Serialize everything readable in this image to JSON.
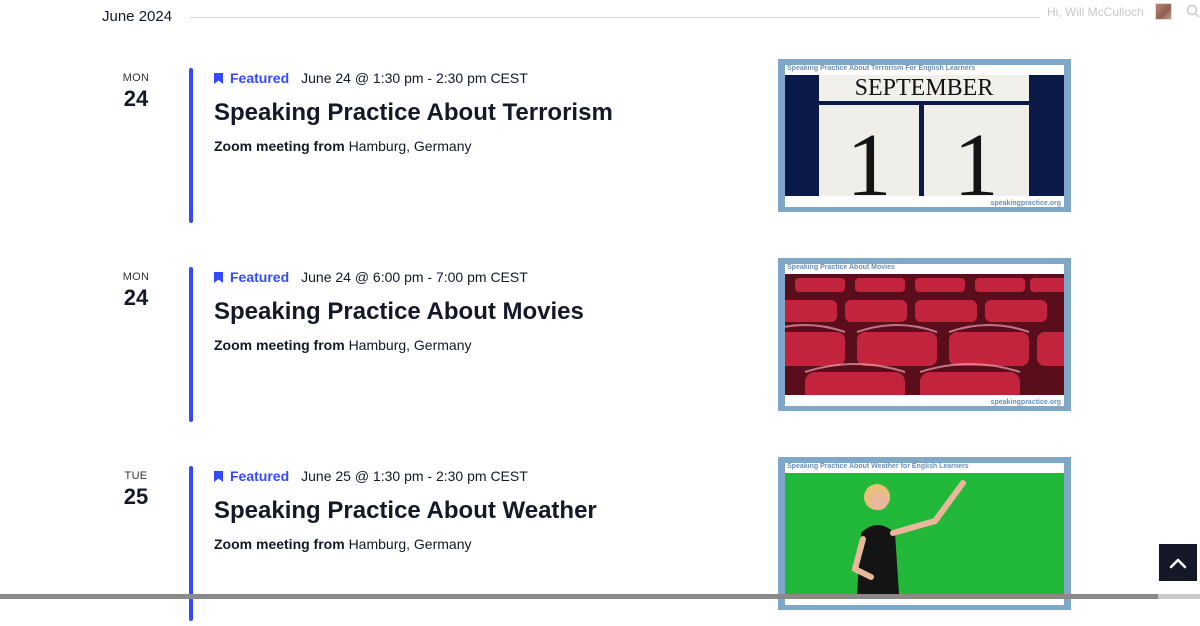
{
  "month": {
    "label": "June 2024"
  },
  "admin": {
    "greeting": "Hi, Will McCulloch"
  },
  "colors": {
    "accent": "#334aff",
    "text": "#141827",
    "thumb_border": "#7fa7c8"
  },
  "events": [
    {
      "weekday": "MON",
      "day": "24",
      "featured_label": "Featured",
      "datetime": "June 24 @ 1:30 pm - 2:30 pm CEST",
      "title": "Speaking Practice About Terrorism",
      "venue_label": "Zoom meeting from",
      "venue_location": "Hamburg, Germany",
      "thumb_caption": "Speaking Practice About Terrorism For English Learners",
      "thumb_credit": "speakingpractice.org",
      "thumb_photo_text": [
        "SEPTEMBER",
        "1",
        "1"
      ]
    },
    {
      "weekday": "MON",
      "day": "24",
      "featured_label": "Featured",
      "datetime": "June 24 @ 6:00 pm - 7:00 pm CEST",
      "title": "Speaking Practice About Movies",
      "venue_label": "Zoom meeting from",
      "venue_location": "Hamburg, Germany",
      "thumb_caption": "Speaking Practice About Movies",
      "thumb_credit": "speakingpractice.org"
    },
    {
      "weekday": "TUE",
      "day": "25",
      "featured_label": "Featured",
      "datetime": "June 25 @ 1:30 pm - 2:30 pm CEST",
      "title": "Speaking Practice About Weather",
      "venue_label": "Zoom meeting from",
      "venue_location": "Hamburg, Germany",
      "thumb_caption": "Speaking Practice About Weather for English Learners"
    }
  ],
  "icons": {
    "bookmark": "bookmark-icon",
    "scroll_top": "chevron-up-icon",
    "search": "search-icon"
  }
}
